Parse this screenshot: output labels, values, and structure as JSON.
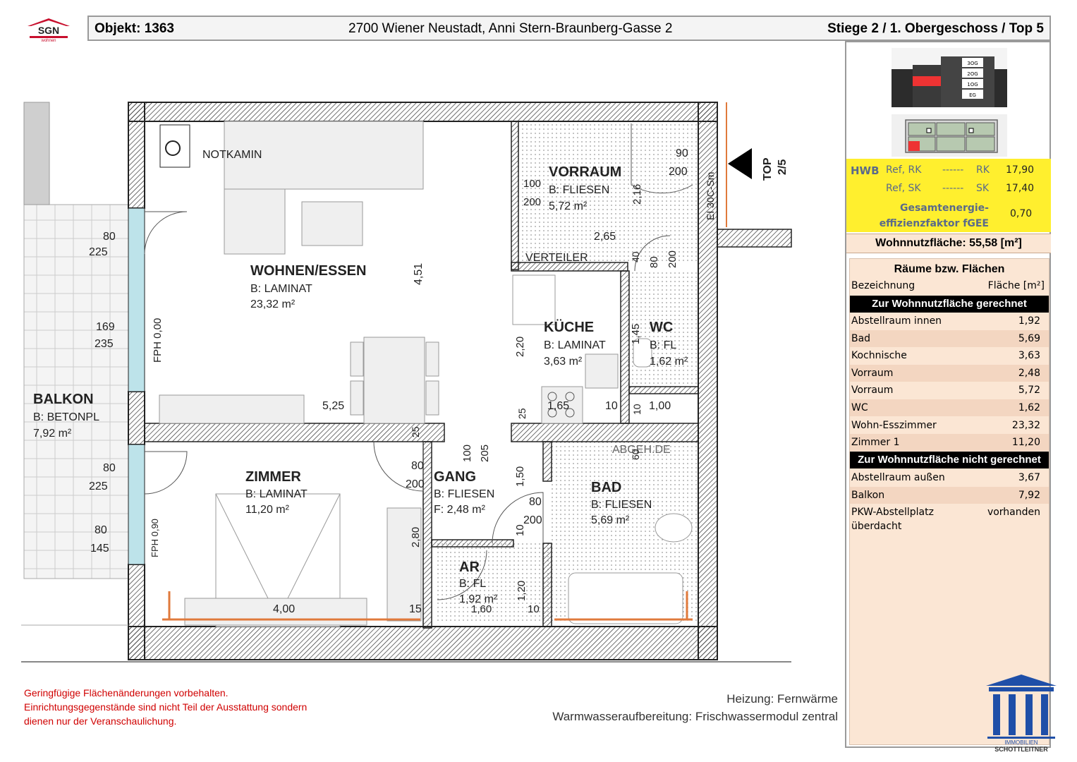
{
  "header": {
    "logo_text": "SGN",
    "logo_sub": "wohnen",
    "object_label": "Objekt:  1363",
    "address": "2700 Wiener Neustadt, Anni Stern-Braunberg-Gasse 2",
    "floor": "Stiege 2 / 1. Obergeschoss / Top 5"
  },
  "thumbs": {
    "floors": [
      "3OG",
      "2OG",
      "1OG",
      "EG"
    ]
  },
  "energy": {
    "hwb": "HWB",
    "ref_rk": "Ref, RK",
    "dash1": "------",
    "rk": "RK",
    "rk_val": "17,90",
    "ref_sk": "Ref, SK",
    "dash2": "------",
    "sk": "SK",
    "sk_val": "17,40",
    "fgee_line1": "Gesamtenergie-",
    "fgee_line2": "effizienzfaktor fGEE",
    "fgee_val": "0,70"
  },
  "wohnnutzflaeche": "Wohnnutzfläche: 55,58 [m²]",
  "rooms": {
    "title": "Räume bzw. Flächen",
    "col_name": "Bezeichnung",
    "col_area": "Fläche [m²]",
    "group1": "Zur Wohnnutzfläche gerechnet",
    "items1": [
      {
        "name": "Abstellraum innen",
        "area": "1,92"
      },
      {
        "name": "Bad",
        "area": "5,69"
      },
      {
        "name": "Kochnische",
        "area": "3,63"
      },
      {
        "name": "Vorraum",
        "area": "2,48"
      },
      {
        "name": "Vorraum",
        "area": "5,72"
      },
      {
        "name": "WC",
        "area": "1,62"
      },
      {
        "name": "Wohn-Esszimmer",
        "area": "23,32"
      },
      {
        "name": "Zimmer 1",
        "area": "11,20"
      }
    ],
    "group2": "Zur Wohnnutzfläche nicht gerechnet",
    "items2": [
      {
        "name": "Abstellraum außen",
        "area": "3,67"
      },
      {
        "name": "Balkon",
        "area": "7,92"
      },
      {
        "name": "PKW-Abstellplatz",
        "name2": "überdacht",
        "area": "vorhanden"
      }
    ]
  },
  "notes": {
    "line1": "Geringfügige Flächenänderungen vorbehalten.",
    "line2": "Einrichtungsgegenstände sind nicht Teil der Ausstattung sondern",
    "line3": "dienen nur der Veranschaulichung."
  },
  "heating": {
    "line1": "Heizung: Fernwärme",
    "line2": "Warmwasseraufbereitung: Frischwassermodul zentral"
  },
  "brand": {
    "line1": "IMMOBILIEN",
    "line2": "SCHOTTLEITNER"
  },
  "plan": {
    "notkamin": "NOTKAMIN",
    "wohnen": "WOHNEN/ESSEN",
    "wohnen_floor": "B: LAMINAT",
    "wohnen_area": "23,32 m²",
    "vorraum": "VORRAUM",
    "vorraum_floor": "B: FLIESEN",
    "vorraum_area": "5,72 m²",
    "verteiler": "VERTEILER",
    "kueche": "KÜCHE",
    "kueche_floor": "B: LAMINAT",
    "kueche_area": "3,63 m²",
    "wc": "WC",
    "wc_floor": "B: FL",
    "wc_area": "1,62 m²",
    "balkon": "BALKON",
    "balkon_floor": "B: BETONPL",
    "balkon_area": "7,92 m²",
    "zimmer": "ZIMMER",
    "zimmer_floor": "B: LAMINAT",
    "zimmer_area": "11,20 m²",
    "gang": "GANG",
    "gang_floor": "B: FLIESEN",
    "gang_area": "F: 2,48 m²",
    "bad": "BAD",
    "bad_floor": "B: FLIESEN",
    "bad_area": "5,69 m²",
    "ar": "AR",
    "ar_floor": "B: FL",
    "ar_area": "1,92 m²",
    "abgeh": "ABGEH.DE",
    "top": "TOP",
    "top_num": "2/5",
    "door_label": "EI 30C-Sm",
    "fph1": "FPH 0,00",
    "fph2": "FPH 0,90",
    "dims": {
      "d_90": "90",
      "d_200a": "200",
      "d_100": "100",
      "d_200b": "200",
      "d_216": "2,16",
      "d_265": "2,65",
      "d_451": "4,51",
      "d_80a": "80",
      "d_225a": "225",
      "d_169": "169",
      "d_235": "235",
      "d_525": "5,25",
      "d_80b": "80",
      "d_225b": "225",
      "d_80c": "80",
      "d_145": "145",
      "d_400": "4,00",
      "d_15": "15",
      "d_80d": "80",
      "d_200c": "200",
      "d_100b": "100",
      "d_205": "205",
      "d_280": "2,80",
      "d_160": "1,60",
      "d_10a": "10",
      "d_120": "1,20",
      "d_150": "1,50",
      "d_80e": "80",
      "d_200d": "200",
      "d_10b": "10",
      "d_220": "2,20",
      "d_165": "1,65",
      "d_10c": "10",
      "d_100c": "1,00",
      "d_10d": "10",
      "d_145b": "1,45",
      "d_80f": "80",
      "d_200e": "200",
      "d_40": "40",
      "d_25": "25",
      "d_25b": "25",
      "d_60": "60"
    }
  }
}
